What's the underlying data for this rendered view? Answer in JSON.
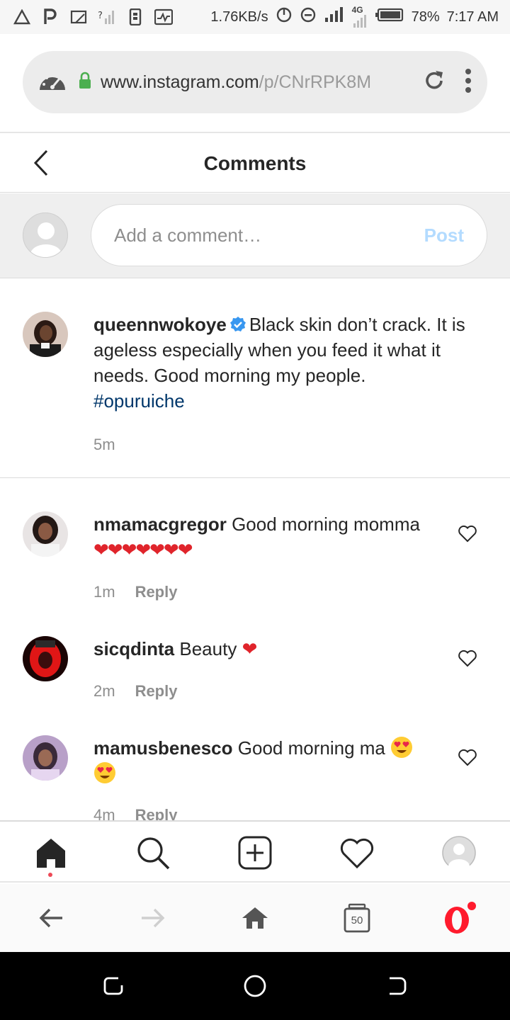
{
  "status_bar": {
    "speed": "1.76KB/s",
    "network": "4G",
    "battery": "78%",
    "time": "7:17 AM"
  },
  "browser": {
    "url_main": "www.instagram.com",
    "url_path": "/p/CNrRPK8M"
  },
  "header": {
    "title": "Comments"
  },
  "add_comment": {
    "placeholder": "Add a comment…",
    "post_label": "Post"
  },
  "caption": {
    "username": "queennwokoye",
    "text": "Black skin don’t crack. It is ageless especially when you feed it what it needs. Good morning my people.",
    "hashtag": "#opuruiche",
    "time": "5m"
  },
  "comments": [
    {
      "username": "nmamacgregor",
      "text": "Good morning momma",
      "emoji": "❤❤❤❤❤❤❤",
      "time": "1m",
      "reply": "Reply"
    },
    {
      "username": "sicqdinta",
      "text": "Beauty",
      "emoji": "❤",
      "time": "2m",
      "reply": "Reply"
    },
    {
      "username": "mamusbenesco",
      "text": "Good morning ma",
      "emoji": "heart-eyes-emoji",
      "time": "4m",
      "reply": "Reply"
    }
  ],
  "browser_bottom": {
    "tabs_count": "50"
  },
  "colors": {
    "link": "#00376b",
    "post_disabled": "#b3dbff",
    "heart_red": "#e0242b",
    "opera_red": "#ff1b2d",
    "secure_green": "#4caf50"
  }
}
